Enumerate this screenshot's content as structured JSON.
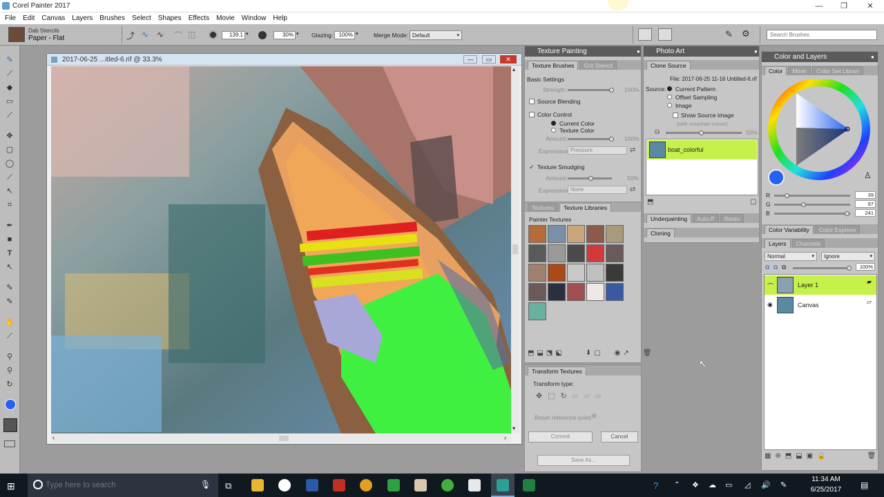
{
  "window": {
    "title": "Corel Painter 2017"
  },
  "menu": [
    "File",
    "Edit",
    "Canvas",
    "Layers",
    "Brushes",
    "Select",
    "Shapes",
    "Effects",
    "Movie",
    "Window",
    "Help"
  ],
  "properties": {
    "brush_category": "Dab Stencils",
    "brush_variant": "Paper - Flat",
    "size_value": "139.1",
    "opacity_value": "30%",
    "glazing_label": "Glazing:",
    "glazing_value": "100%",
    "merge_mode_label": "Merge Mode:",
    "merge_mode_value": "Default",
    "search_placeholder": "Search Brushes"
  },
  "document": {
    "title": "2017-06-25 ...itled-6.rif @ 33.3%"
  },
  "texture_painting": {
    "title": "Texture Painting",
    "tabs": [
      "Texture Brushes",
      "Grit Stencil"
    ],
    "basic_settings": "Basic Settings",
    "strength_label": "Strength:",
    "strength_value": "100%",
    "source_blending": "Source Blending",
    "color_control": "Color Control",
    "current_color": "Current Color",
    "texture_color": "Texture Color",
    "amount_label": "Amount:",
    "amount_value": "100%",
    "expression_label": "Expression:",
    "expression_value": "Pressure",
    "texture_smudging": "Texture Smudging",
    "smudge_amount_label": "Amount:",
    "smudge_amount_value": "50%",
    "smudge_expression_label": "Expression:",
    "smudge_expression_value": "None"
  },
  "texture_libraries": {
    "tabs": [
      "Textures",
      "Texture Libraries"
    ],
    "library_name": "Painter Textures",
    "swatch_colors": [
      "#b66b3a",
      "#7a8fa8",
      "#c9a77a",
      "#8c5a4a",
      "#a89a7a",
      "#5a5a5a",
      "#9a9a9a",
      "#4a4a4a",
      "#d03a3a",
      "#6a5a5a",
      "#a08070",
      "#a84a1a",
      "#c8c8c8",
      "#c0c0c0",
      "#3a3a3a",
      "#6a5a5a",
      "#2a3040",
      "#a05050",
      "#f0e8e8",
      "#3a5aa0",
      "#6ab0a0"
    ]
  },
  "transform_textures": {
    "title": "Transform Textures",
    "transform_type": "Transform type:",
    "reset_label": "Reset reference point:",
    "commit": "Commit",
    "cancel": "Cancel",
    "save_as": "Save As..."
  },
  "photo_art": {
    "title": "Photo Art",
    "tab": "Clone Source",
    "file_label": "File: 2017-06-25 11-16 Untitled-6.rif",
    "source_label": "Source:",
    "current_pattern": "Current Pattern",
    "offset_sampling": "Offset Sampling",
    "image": "Image",
    "show_source_image": "Show Source Image",
    "crosshair_note": "(with crosshair cursor)",
    "opacity_value": "50%",
    "source_name": "boat_colorful",
    "underpainting": "Underpainting",
    "auto_p": "Auto-P",
    "restore": "Resto",
    "cloning": "Cloning"
  },
  "color_layers": {
    "title": "Color and Layers",
    "color_tabs": [
      "Color",
      "Mixer",
      "Color Set Librari"
    ],
    "r_label": "R",
    "r_value": "39",
    "g_label": "G",
    "g_value": "97",
    "b_label": "B",
    "b_value": "241",
    "opacity_value": "100%",
    "current_color": "#2761f1",
    "variability_tabs": [
      "Color Variability",
      "Color Express"
    ],
    "layers_tabs": [
      "Layers",
      "Channels"
    ],
    "composite_method": "Normal",
    "composite_depth": "Ignore",
    "layer_opacity": "100%",
    "layers": [
      {
        "name": "Layer 1",
        "selected": true
      },
      {
        "name": "Canvas",
        "selected": false
      }
    ]
  },
  "taskbar": {
    "search_placeholder": "Type here to search",
    "time": "11:34 AM",
    "date": "6/25/2017"
  }
}
